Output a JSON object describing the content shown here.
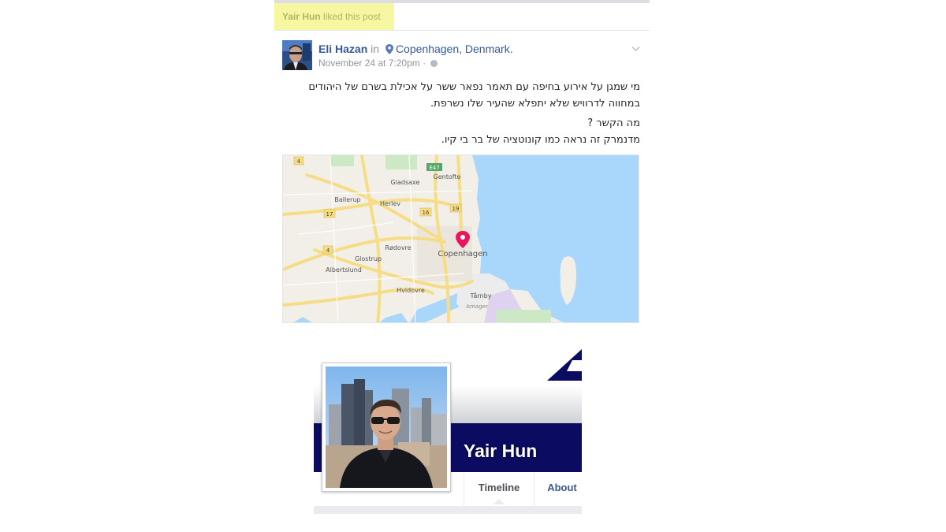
{
  "story": {
    "actor": "Yair Hun",
    "action": "liked this post",
    "highlight_color": "#f7f7a1"
  },
  "post": {
    "author": "Eli Hazan",
    "in_word": "in",
    "location": "Copenhagen, Denmark.",
    "timestamp": "November 24 at 7:20pm",
    "separator": "·",
    "privacy_icon": "globe-icon",
    "options_icon": "chevron-down-icon",
    "body": [
      "מי שמגן על אירוע בחיפה עם תאמר נפאר ששר על אכילת בשרם של היהודים במחווה לדרוויש שלא יתפלא שהעיר שלו נשרפת.",
      "מה הקשר ?",
      "מדנמרק זה נראה כמו קונוטציה של בר בי קיו."
    ]
  },
  "map": {
    "pin_label": "Copenhagen",
    "places": [
      "Gladsaxe",
      "Gentofte",
      "Ballerup",
      "Herlev",
      "Rødovre",
      "Glostrup",
      "Albertslund",
      "Hvidovre",
      "Tårnby",
      "Amager"
    ],
    "roads": [
      "E47",
      "19",
      "16",
      "17",
      "4",
      "4"
    ],
    "pin_color": "#e8175d",
    "water_color": "#a9d7fb",
    "land_color": "#f2efe9",
    "road_color": "#f6dd85"
  },
  "profile": {
    "name": "Yair Hun",
    "tabs": [
      "Timeline",
      "About"
    ],
    "band_color": "#0b0c61",
    "logo_icon": "triangle-logo-icon"
  }
}
